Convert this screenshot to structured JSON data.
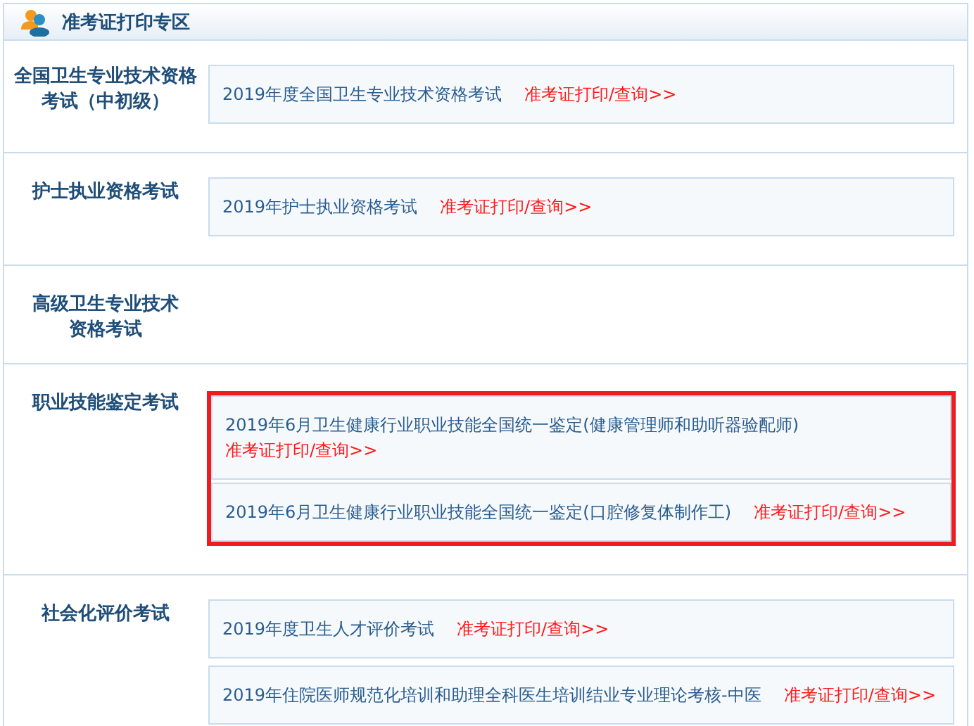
{
  "header": {
    "title": "准考证打印专区"
  },
  "sections": [
    {
      "label": "全国卫生专业技术资格考试（中初级）",
      "highlighted": false,
      "items": [
        {
          "text": "2019年度全国卫生专业技术资格考试",
          "link": "准考证打印/查询>>"
        }
      ]
    },
    {
      "label": "护士执业资格考试",
      "highlighted": false,
      "items": [
        {
          "text": "2019年护士执业资格考试",
          "link": "准考证打印/查询>>"
        }
      ]
    },
    {
      "label": "高级卫生专业技术资格考试"
    },
    {
      "label": "职业技能鉴定考试",
      "highlighted": true,
      "items": [
        {
          "text": "2019年6月卫生健康行业职业技能全国统一鉴定(健康管理师和助听器验配师)",
          "link": "准考证打印/查询>>"
        },
        {
          "text": "2019年6月卫生健康行业职业技能全国统一鉴定(口腔修复体制作工)",
          "link": "准考证打印/查询>>"
        }
      ]
    },
    {
      "label": "社会化评价考试",
      "highlighted": false,
      "items": [
        {
          "text": "2019年度卫生人才评价考试",
          "link": "准考证打印/查询>>"
        },
        {
          "text": "2019年住院医师规范化培训和助理全科医生培训结业专业理论考核-中医",
          "link": "准考证打印/查询>>"
        }
      ]
    }
  ]
}
